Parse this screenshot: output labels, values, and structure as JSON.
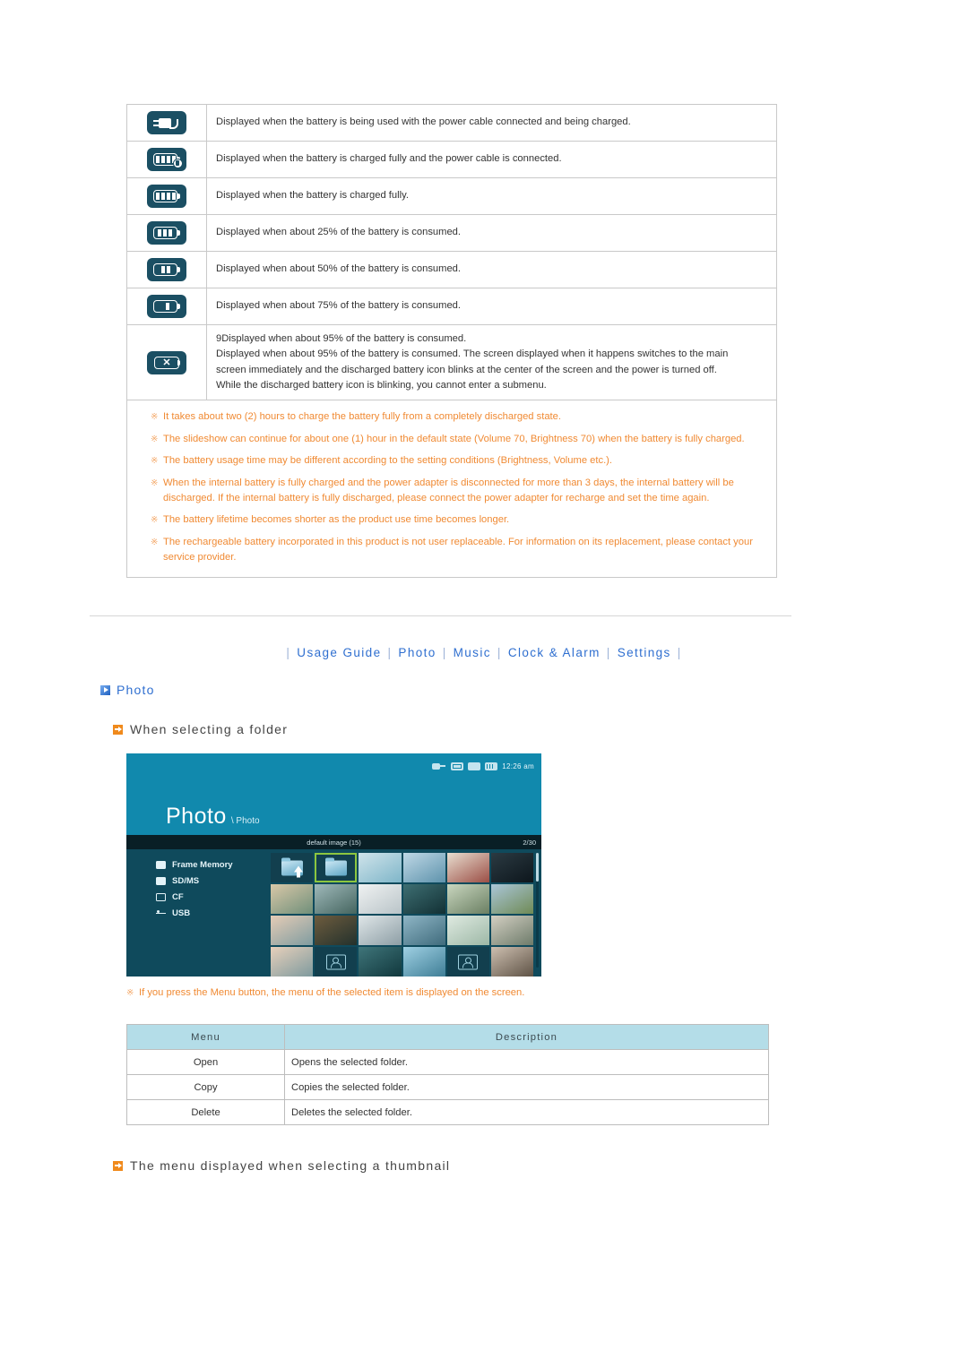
{
  "battery_table": {
    "rows": [
      {
        "icon": "battery-charging-plug-icon",
        "lines": [
          "Displayed when the battery is being used with the power cable connected and being charged."
        ]
      },
      {
        "icon": "battery-full-with-cable-icon",
        "lines": [
          "Displayed when the battery is charged fully and the power cable is connected."
        ]
      },
      {
        "icon": "battery-full-icon",
        "lines": [
          "Displayed when the battery is charged fully."
        ]
      },
      {
        "icon": "battery-75-icon",
        "lines": [
          "Displayed when about 25% of the battery is consumed."
        ]
      },
      {
        "icon": "battery-50-icon",
        "lines": [
          "Displayed when about 50% of the battery is consumed."
        ]
      },
      {
        "icon": "battery-25-icon",
        "lines": [
          "Displayed when about 75% of the battery is consumed."
        ]
      },
      {
        "icon": "battery-empty-x-icon",
        "lines": [
          "9Displayed when about 95% of the battery is consumed.",
          "Displayed when about 95% of the battery is consumed. The screen displayed when it happens switches to the main",
          "screen immediately and the discharged battery icon blinks at the center of the screen and the power is turned off.",
          "While the discharged battery icon is blinking, you cannot enter a submenu."
        ]
      }
    ],
    "notes_mark": "※",
    "notes": [
      "It takes about two (2) hours to charge the battery fully from a completely discharged state.",
      "The slideshow can continue for about one (1) hour in the default state (Volume 70, Brightness 70) when the battery is fully charged.",
      "The battery usage time may be different according to the setting conditions (Brightness, Volume etc.).",
      "When the internal battery is fully charged and the power adapter is disconnected for more than 3 days, the internal battery will be discharged. If the internal battery is fully discharged, please connect the power adapter for recharge and set the time again.",
      "The battery lifetime becomes shorter as the product use time becomes longer.",
      "The rechargeable battery incorporated in this product is not user replaceable. For information on its replacement, please contact your service provider."
    ]
  },
  "navbar": {
    "separator": "|",
    "items": [
      {
        "label": "Usage Guide"
      },
      {
        "label": "Photo"
      },
      {
        "label": "Music"
      },
      {
        "label": "Clock & Alarm"
      },
      {
        "label": "Settings"
      }
    ]
  },
  "headings": {
    "section": "Photo",
    "sub_folder": "When selecting a folder",
    "sub_thumbnail": "The menu displayed when selecting a thumbnail"
  },
  "device": {
    "title": "Photo",
    "breadcrumb": "\\ Photo",
    "clock": "12:26 am",
    "status_icons": [
      "power-plug-icon",
      "sd-card-icon",
      "memory-icon",
      "battery-icon"
    ],
    "folder_label": "default image (15)",
    "page_indicator": "2/30",
    "sidebar": [
      {
        "label": "Frame Memory",
        "icon": "frame-memory-icon"
      },
      {
        "label": "SD/MS",
        "icon": "sd-ms-icon"
      },
      {
        "label": "CF",
        "icon": "cf-card-icon"
      },
      {
        "label": "USB",
        "icon": "usb-icon"
      }
    ],
    "grid": [
      [
        {
          "type": "folder-up"
        },
        {
          "type": "folder",
          "selected": true
        },
        {
          "type": "photo",
          "c1": "#cfe3ea",
          "c2": "#7fb6c9"
        },
        {
          "type": "photo",
          "c1": "#bfd8e6",
          "c2": "#5e93ac"
        },
        {
          "type": "photo",
          "c1": "#e8ded0",
          "c2": "#9b4e45"
        },
        {
          "type": "photo",
          "c1": "#2b3a42",
          "c2": "#0d161c"
        }
      ],
      [
        {
          "type": "photo",
          "c1": "#d9c8a8",
          "c2": "#6f8f7a"
        },
        {
          "type": "photo",
          "c1": "#9fb9ba",
          "c2": "#45655f"
        },
        {
          "type": "photo",
          "c1": "#f0f2f2",
          "c2": "#b9c4c8"
        },
        {
          "type": "photo",
          "c1": "#3e6f73",
          "c2": "#123034"
        },
        {
          "type": "photo",
          "c1": "#c9d6bf",
          "c2": "#6a7f62"
        },
        {
          "type": "photo",
          "c1": "#aac6d8",
          "c2": "#6f8a55"
        }
      ],
      [
        {
          "type": "photo",
          "c1": "#e5ccb6",
          "c2": "#7f9ca0"
        },
        {
          "type": "photo",
          "c1": "#6e5c3e",
          "c2": "#23312c"
        },
        {
          "type": "photo",
          "c1": "#dfe6e8",
          "c2": "#8d9ea5"
        },
        {
          "type": "photo",
          "c1": "#8fb6c6",
          "c2": "#3f6b7c"
        },
        {
          "type": "photo",
          "c1": "#dfeae1",
          "c2": "#9db8a6"
        },
        {
          "type": "photo",
          "c1": "#d3cfc2",
          "c2": "#6d7b6a"
        }
      ],
      [
        {
          "type": "photo",
          "c1": "#e7d0bb",
          "c2": "#7e9a9e"
        },
        {
          "type": "person"
        },
        {
          "type": "photo",
          "c1": "#3f757a",
          "c2": "#11383d"
        },
        {
          "type": "photo",
          "c1": "#9fd0e3",
          "c2": "#3f7e96"
        },
        {
          "type": "person"
        },
        {
          "type": "photo",
          "c1": "#cdbfb0",
          "c2": "#5e5245"
        }
      ]
    ],
    "note_mark": "※",
    "note": "If you press the Menu button, the menu of the selected item is displayed on the screen."
  },
  "menu_table": {
    "headers": {
      "menu": "Menu",
      "description": "Description"
    },
    "rows": [
      {
        "menu": "Open",
        "description": "Opens the selected folder."
      },
      {
        "menu": "Copy",
        "description": "Copies the selected folder."
      },
      {
        "menu": "Delete",
        "description": "Deletes the selected folder."
      }
    ]
  },
  "colors": {
    "link_blue": "#2f6fd0",
    "note_orange": "#f08a33",
    "table_header_teal": "#b4dde8",
    "device_header_blue": "#1189ad",
    "device_body_teal": "#0f4a5c",
    "icon_navy": "#1b4f63",
    "selection_green": "#8cc63f"
  }
}
